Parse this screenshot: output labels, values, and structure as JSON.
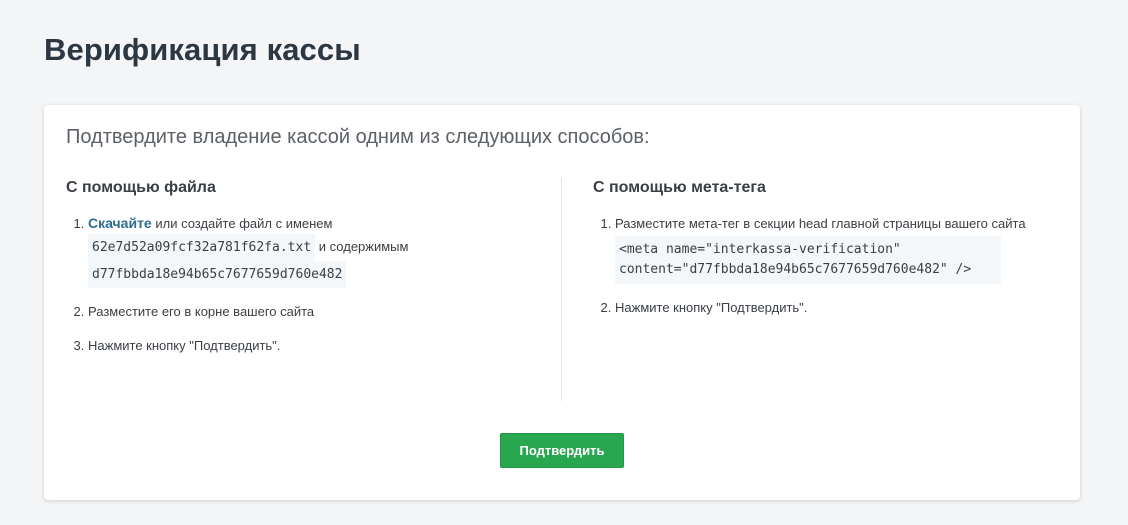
{
  "page": {
    "title": "Верификация кассы"
  },
  "card": {
    "intro": "Подтвердите владение кассой одним из следующих способов:",
    "file_method": {
      "heading": "С помощью файла",
      "step1_link": "Скачайте",
      "step1_text_a": "или создайте файл с именем",
      "file_name": "62e7d52a09fcf32a781f62fa.txt",
      "step1_text_b": "и содержимым",
      "file_content": "d77fbbda18e94b65c7677659d760e482",
      "step2": "Разместите его в корне вашего сайта",
      "step3": "Нажмите кнопку \"Подтвердить\"."
    },
    "meta_method": {
      "heading": "С помощью мета-тега",
      "step1": "Разместите мета-тег в секции head главной страницы вашего сайта",
      "meta_tag_line1": "<meta name=\"interkassa-verification\"",
      "meta_tag_line2": "content=\"d77fbbda18e94b65c7677659d760e482\" />",
      "step2": "Нажмите кнопку \"Подтвердить\"."
    },
    "confirm_label": "Подтвердить"
  },
  "colors": {
    "accent_green": "#28a74f",
    "link_blue": "#2b6d93",
    "code_bg": "#f3f7fa"
  }
}
